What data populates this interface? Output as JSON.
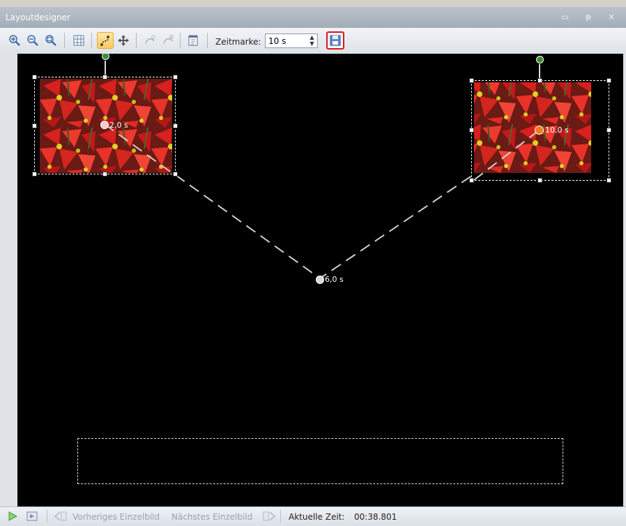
{
  "window": {
    "title": "Layoutdesigner",
    "controls": [
      "▭",
      "ᵽ",
      "×"
    ]
  },
  "toolbar": {
    "zeitmarke_label": "Zeitmarke:",
    "zeitmarke_value": "10 s",
    "spin_up": "▲",
    "spin_down": "▼"
  },
  "canvas": {
    "keyframes": [
      {
        "time": "2,0 s",
        "color": "#f3c9c9"
      },
      {
        "time": "6,0 s",
        "color": "#d9d9d9"
      },
      {
        "time": "10,0 s",
        "color": "#f07c1c"
      }
    ]
  },
  "statusbar": {
    "prev_frame": "Vorheriges Einzelbild",
    "next_frame": "Nächstes Einzelbild",
    "current_time_label": "Aktuelle Zeit:",
    "current_time_value": "00:38.801"
  },
  "colors": {
    "highlight": "#e2141a",
    "canvas_bg": "#000000",
    "rotation_handle": "#3f8a35",
    "keyframe_end": "#f07c1c"
  }
}
